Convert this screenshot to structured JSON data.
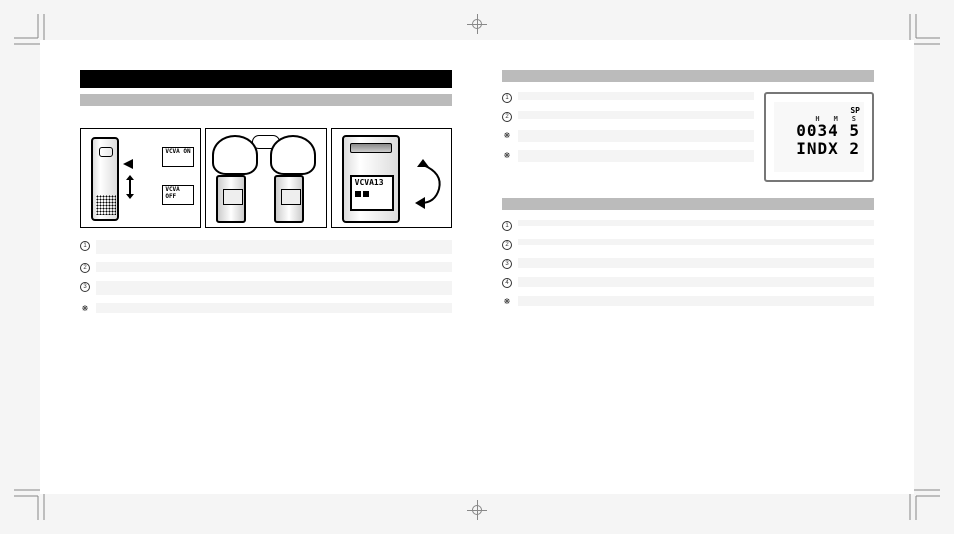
{
  "left": {
    "panel1": {
      "vcva_on": "VCVA\nON",
      "vcva_off": "VCVA\nOFF"
    },
    "panel3": {
      "screen_text": "VCVA13"
    },
    "steps": [
      {
        "num": "1",
        "text": ""
      },
      {
        "num": "2",
        "text": ""
      },
      {
        "num": "3",
        "text": ""
      },
      {
        "num": "❋",
        "text": ""
      }
    ]
  },
  "right": {
    "lcd": {
      "mode": "SP",
      "h_label": "H",
      "m_label": "M",
      "s_label": "S",
      "time": "0034 5",
      "indx": "INDX 2"
    },
    "top_steps": [
      {
        "num": "1",
        "text": ""
      },
      {
        "num": "2",
        "text": ""
      },
      {
        "num": "❋",
        "text": ""
      },
      {
        "num": "❋",
        "text": ""
      }
    ],
    "bottom_steps": [
      {
        "num": "1",
        "text": ""
      },
      {
        "num": "2",
        "text": ""
      },
      {
        "num": "3",
        "text": ""
      },
      {
        "num": "4",
        "text": ""
      },
      {
        "num": "❋",
        "text": ""
      }
    ]
  }
}
